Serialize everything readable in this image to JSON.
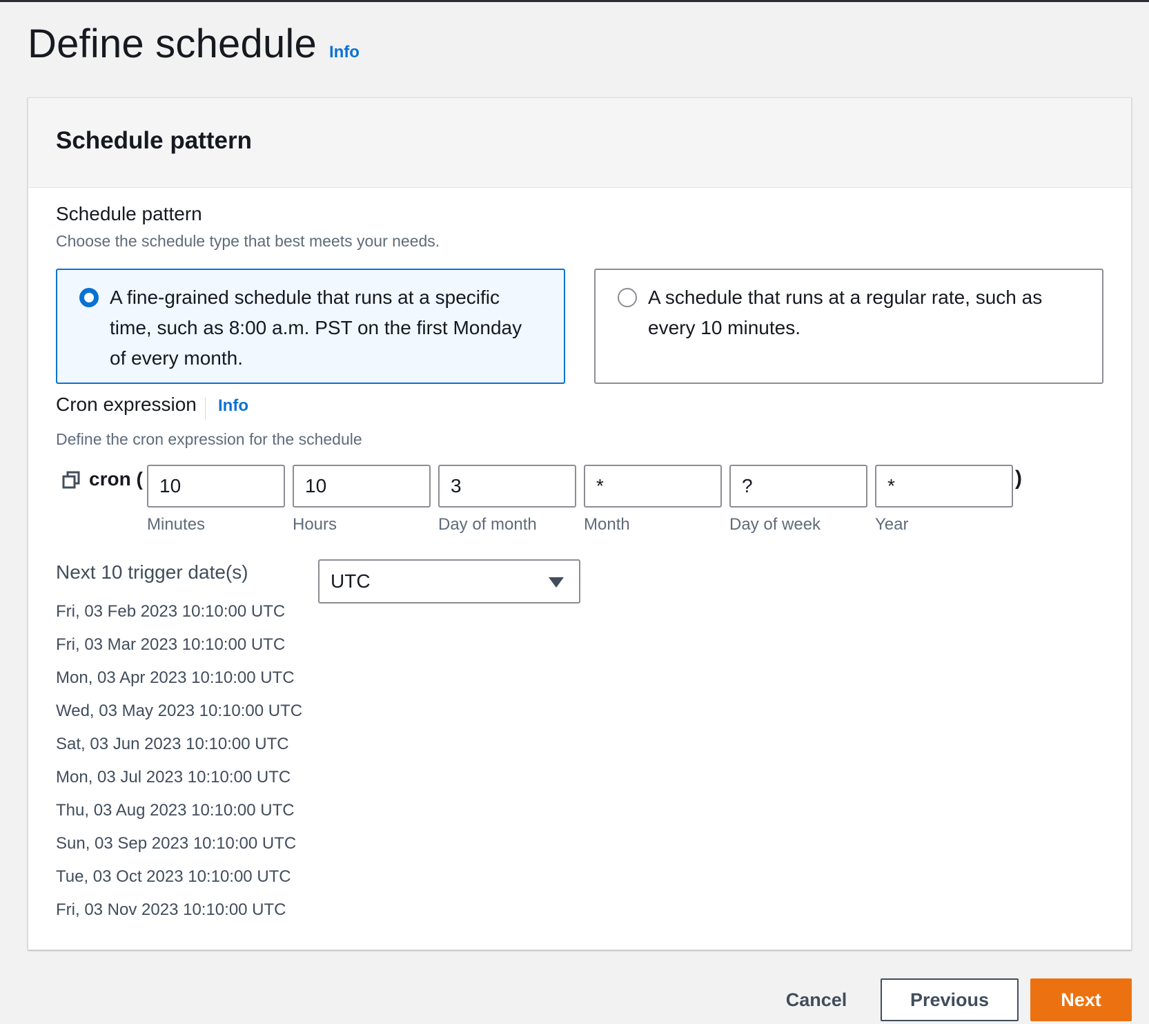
{
  "page": {
    "title": "Define schedule",
    "info_label": "Info"
  },
  "panel": {
    "title": "Schedule pattern"
  },
  "schedule_pattern": {
    "label": "Schedule pattern",
    "description": "Choose the schedule type that best meets your needs.",
    "options": [
      {
        "label": "A fine-grained schedule that runs at a specific time, such as 8:00 a.m. PST on the first Monday of every month.",
        "selected": true
      },
      {
        "label": "A schedule that runs at a regular rate, such as every 10 minutes.",
        "selected": false
      }
    ]
  },
  "cron": {
    "label": "Cron expression",
    "info_label": "Info",
    "description": "Define the cron expression for the schedule",
    "prefix": "cron (",
    "suffix": ")",
    "fields": [
      {
        "value": "10",
        "caption": "Minutes"
      },
      {
        "value": "10",
        "caption": "Hours"
      },
      {
        "value": "3",
        "caption": "Day of month"
      },
      {
        "value": "*",
        "caption": "Month"
      },
      {
        "value": "?",
        "caption": "Day of week"
      },
      {
        "value": "*",
        "caption": "Year"
      }
    ]
  },
  "triggers": {
    "title": "Next 10 trigger date(s)",
    "timezone": "UTC",
    "dates": [
      "Fri, 03 Feb 2023 10:10:00 UTC",
      "Fri, 03 Mar 2023 10:10:00 UTC",
      "Mon, 03 Apr 2023 10:10:00 UTC",
      "Wed, 03 May 2023 10:10:00 UTC",
      "Sat, 03 Jun 2023 10:10:00 UTC",
      "Mon, 03 Jul 2023 10:10:00 UTC",
      "Thu, 03 Aug 2023 10:10:00 UTC",
      "Sun, 03 Sep 2023 10:10:00 UTC",
      "Tue, 03 Oct 2023 10:10:00 UTC",
      "Fri, 03 Nov 2023 10:10:00 UTC"
    ]
  },
  "footer": {
    "cancel_label": "Cancel",
    "previous_label": "Previous",
    "next_label": "Next"
  },
  "colors": {
    "accent": "#0972d3",
    "primary_button": "#ec7211",
    "selected_tile_bg": "#f1f8ff"
  }
}
